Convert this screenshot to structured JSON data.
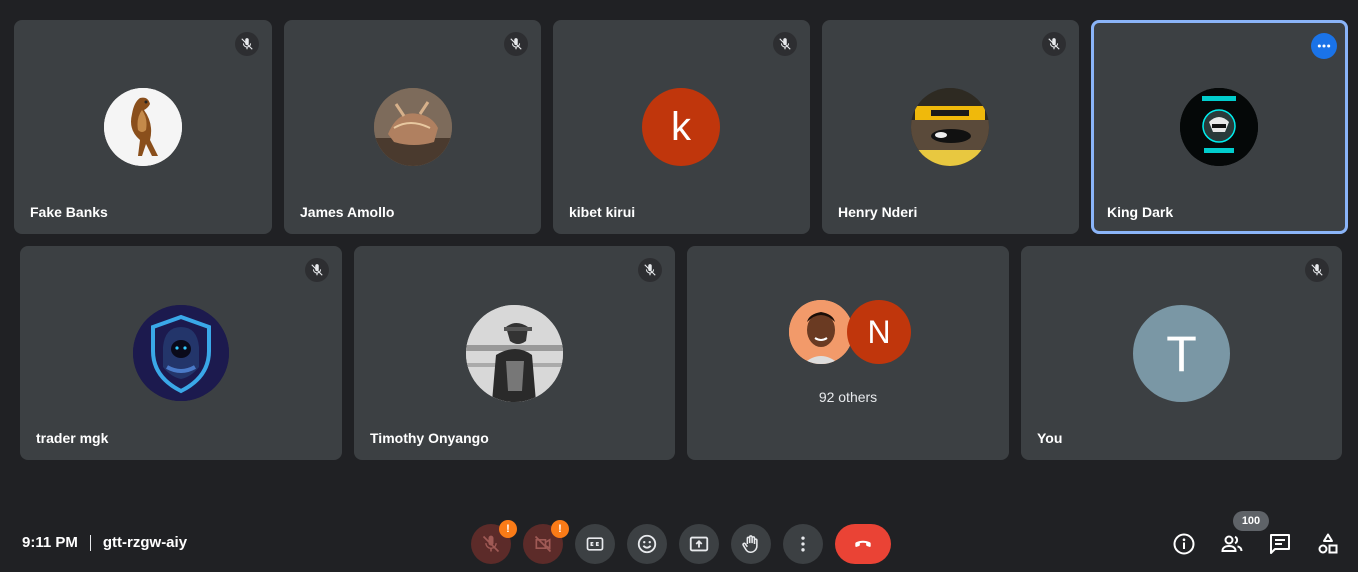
{
  "participants_row1": [
    {
      "name": "Fake Banks",
      "muted": true
    },
    {
      "name": "James Amollo",
      "muted": true
    },
    {
      "name": "kibet kirui",
      "muted": true,
      "initial": "k",
      "color": "#c0360c"
    },
    {
      "name": "Henry Nderi",
      "muted": true
    },
    {
      "name": "King Dark",
      "muted": false,
      "active": true
    }
  ],
  "participants_row2": [
    {
      "name": "trader mgk",
      "muted": true
    },
    {
      "name": "Timothy Onyango",
      "muted": true
    },
    {
      "name": "You",
      "muted": true,
      "initial": "T",
      "color": "#7a97a5"
    }
  ],
  "others_tile": {
    "label": "92 others",
    "initial": "N",
    "color": "#c0360c"
  },
  "meeting": {
    "time": "9:11 PM",
    "code": "gtt-rzgw-aiy"
  },
  "controls": {
    "mic_badge": "!",
    "cam_badge": "!",
    "people_count": "100"
  },
  "colors": {
    "background": "#202124",
    "tile": "#3c4043",
    "accent": "#8ab4f8",
    "hangup": "#ea4335",
    "warning": "#fa7b17"
  }
}
